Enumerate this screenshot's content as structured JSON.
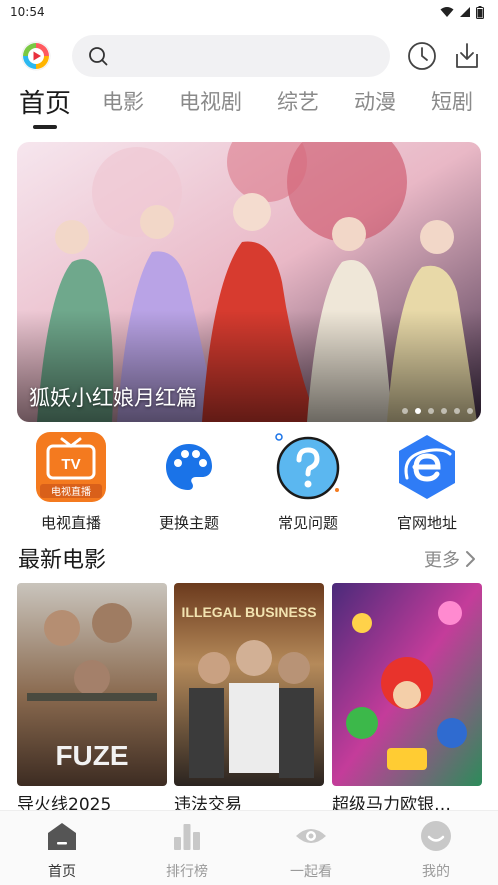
{
  "status_bar": {
    "time": "10:54"
  },
  "search": {
    "placeholder": ""
  },
  "tabs": [
    {
      "label": "首页",
      "active": true
    },
    {
      "label": "电影",
      "active": false
    },
    {
      "label": "电视剧",
      "active": false
    },
    {
      "label": "综艺",
      "active": false
    },
    {
      "label": "动漫",
      "active": false
    },
    {
      "label": "短剧",
      "active": false
    }
  ],
  "banner": {
    "title": "狐妖小红娘月红篇",
    "dot_count": 6,
    "active_dot": 1
  },
  "shortcuts": [
    {
      "label": "电视直播",
      "icon": "tv-live-icon",
      "icon_text": "TV",
      "badge": "电视直播",
      "color": "#f47a1f"
    },
    {
      "label": "更换主题",
      "icon": "palette-icon",
      "color": "#1a73e8"
    },
    {
      "label": "常见问题",
      "icon": "question-icon",
      "color": "#5bb7f0"
    },
    {
      "label": "官网地址",
      "icon": "browser-e-icon",
      "color": "#2f7cf6"
    }
  ],
  "section": {
    "title": "最新电影",
    "more": "更多"
  },
  "movies": [
    {
      "title": "导火线2025",
      "poster_text": "FUZE"
    },
    {
      "title": "违法交易",
      "poster_text": "ILLEGAL BUSINESS"
    },
    {
      "title": "超级马力欧银…",
      "poster_text": ""
    }
  ],
  "bottom_nav": [
    {
      "label": "首页",
      "icon": "home-icon",
      "active": true
    },
    {
      "label": "排行榜",
      "icon": "ranking-icon",
      "active": false
    },
    {
      "label": "一起看",
      "icon": "eye-icon",
      "active": false
    },
    {
      "label": "我的",
      "icon": "profile-icon",
      "active": false
    }
  ],
  "colors": {
    "accent": "#222222",
    "muted": "#8a8a8a",
    "search_bg": "#f1f1f3"
  }
}
